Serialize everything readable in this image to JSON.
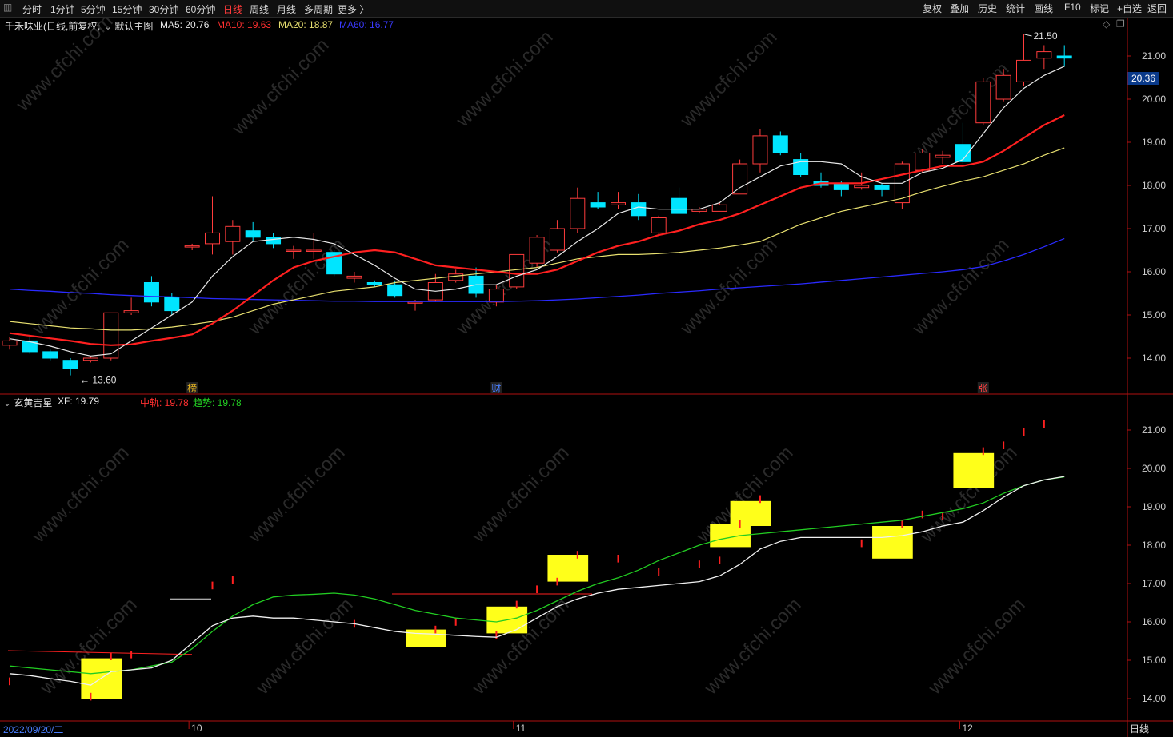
{
  "toolbar": {
    "left_items": [
      "分时",
      "1分钟",
      "5分钟",
      "15分钟",
      "30分钟",
      "60分钟",
      "日线",
      "周线",
      "月线",
      "多周期",
      "更多 〉"
    ],
    "active": "日线",
    "right_items": [
      "复权",
      "叠加",
      "历史",
      "统计",
      "画线",
      "F10",
      "标记",
      "+自选",
      "返回"
    ]
  },
  "main_panel": {
    "title": "千禾味业(日线,前复权)",
    "template": "默认主图",
    "ma5": "MA5: 20.76",
    "ma10": "MA10: 19.63",
    "ma20": "MA20: 18.87",
    "ma60": "MA60: 16.77",
    "y_ticks": [
      "21.00",
      "20.00",
      "19.00",
      "18.00",
      "17.00",
      "16.00",
      "15.00",
      "14.00"
    ],
    "current_price": "20.36",
    "high_label": "21.50",
    "low_label": "13.60",
    "markers": [
      "榜",
      "财",
      "张"
    ]
  },
  "sub_panel": {
    "title": "玄黄吉星",
    "xf": "XF: 19.79",
    "zhonggui": "中轨: 19.78",
    "qushi": "趋势: 19.78",
    "y_ticks": [
      "21.00",
      "20.00",
      "19.00",
      "18.00",
      "17.00",
      "16.00",
      "15.00",
      "14.00"
    ]
  },
  "x_axis": {
    "start_date": "2022/09/20/二",
    "month_labels": [
      "10",
      "11",
      "12"
    ],
    "period": "日线"
  },
  "watermark": "www.cfchi.com",
  "colors": {
    "up": "#ff3c3c",
    "down": "#00e5ff",
    "ma5": "#e8e8e8",
    "ma10": "#ff2020",
    "ma20": "#e8e070",
    "ma60": "#2a2aff",
    "signal_box": "#ffff1a",
    "trend_green": "#22cc22"
  },
  "chart_data": {
    "type": "candlestick",
    "ohlc": [
      [
        14.3,
        14.5,
        14.2,
        14.4
      ],
      [
        14.4,
        14.5,
        14.1,
        14.15
      ],
      [
        14.15,
        14.2,
        13.95,
        14.0
      ],
      [
        13.95,
        14.0,
        13.6,
        13.75
      ],
      [
        13.95,
        14.05,
        13.9,
        14.0
      ],
      [
        14.0,
        15.05,
        13.95,
        15.05
      ],
      [
        15.05,
        15.4,
        15.0,
        15.1
      ],
      [
        15.75,
        15.9,
        15.2,
        15.3
      ],
      [
        15.4,
        15.5,
        15.0,
        15.1
      ],
      [
        16.6,
        16.65,
        16.5,
        16.6
      ],
      [
        16.65,
        17.75,
        16.4,
        16.9
      ],
      [
        16.7,
        17.2,
        16.4,
        17.05
      ],
      [
        16.95,
        17.15,
        16.7,
        16.8
      ],
      [
        16.8,
        16.9,
        16.55,
        16.65
      ],
      [
        16.5,
        16.6,
        16.3,
        16.5
      ],
      [
        16.5,
        16.9,
        16.3,
        16.5
      ],
      [
        16.45,
        16.5,
        15.9,
        15.95
      ],
      [
        15.85,
        16.0,
        15.75,
        15.9
      ],
      [
        15.75,
        15.8,
        15.65,
        15.7
      ],
      [
        15.7,
        15.8,
        15.4,
        15.45
      ],
      [
        15.3,
        15.35,
        15.1,
        15.3
      ],
      [
        15.35,
        15.95,
        15.3,
        15.75
      ],
      [
        15.8,
        16.05,
        15.75,
        15.95
      ],
      [
        15.9,
        16.1,
        15.4,
        15.5
      ],
      [
        15.3,
        15.7,
        15.2,
        15.6
      ],
      [
        15.65,
        16.4,
        15.6,
        16.4
      ],
      [
        16.2,
        16.85,
        16.1,
        16.8
      ],
      [
        16.5,
        17.2,
        16.45,
        17.0
      ],
      [
        17.0,
        17.95,
        16.9,
        17.7
      ],
      [
        17.6,
        17.85,
        17.45,
        17.5
      ],
      [
        17.55,
        17.85,
        17.45,
        17.6
      ],
      [
        17.6,
        17.8,
        17.2,
        17.3
      ],
      [
        16.9,
        17.3,
        16.85,
        17.25
      ],
      [
        17.7,
        17.95,
        17.35,
        17.35
      ],
      [
        17.4,
        17.5,
        17.35,
        17.45
      ],
      [
        17.4,
        17.6,
        17.4,
        17.55
      ],
      [
        17.8,
        18.6,
        17.8,
        18.5
      ],
      [
        18.5,
        19.3,
        18.3,
        19.15
      ],
      [
        19.15,
        19.25,
        18.7,
        18.75
      ],
      [
        18.6,
        18.75,
        18.2,
        18.25
      ],
      [
        18.1,
        18.3,
        17.95,
        18.0
      ],
      [
        18.05,
        18.1,
        17.75,
        17.9
      ],
      [
        17.95,
        18.3,
        17.9,
        18.0
      ],
      [
        18.0,
        18.05,
        17.75,
        17.9
      ],
      [
        17.6,
        18.55,
        17.45,
        18.5
      ],
      [
        18.35,
        18.85,
        18.3,
        18.75
      ],
      [
        18.65,
        18.8,
        18.5,
        18.7
      ],
      [
        18.95,
        19.45,
        18.5,
        18.55
      ],
      [
        19.45,
        20.5,
        19.4,
        20.4
      ],
      [
        20.0,
        20.7,
        19.95,
        20.55
      ],
      [
        20.4,
        21.5,
        20.3,
        20.9
      ],
      [
        20.95,
        21.25,
        20.7,
        21.1
      ],
      [
        21.0,
        21.25,
        20.75,
        20.95
      ]
    ],
    "ma5": [
      14.45,
      14.38,
      14.28,
      14.15,
      14.05,
      14.1,
      14.4,
      14.7,
      15.0,
      15.3,
      15.9,
      16.35,
      16.7,
      16.75,
      16.8,
      16.75,
      16.65,
      16.4,
      16.15,
      15.85,
      15.6,
      15.55,
      15.6,
      15.7,
      15.7,
      15.9,
      16.05,
      16.35,
      16.7,
      17.0,
      17.35,
      17.5,
      17.45,
      17.45,
      17.45,
      17.6,
      17.95,
      18.2,
      18.45,
      18.55,
      18.55,
      18.5,
      18.2,
      18.05,
      18.05,
      18.3,
      18.4,
      18.6,
      19.2,
      19.8,
      20.25,
      20.55,
      20.76
    ],
    "ma10": [
      14.58,
      14.52,
      14.46,
      14.4,
      14.33,
      14.3,
      14.32,
      14.4,
      14.47,
      14.55,
      14.8,
      15.1,
      15.45,
      15.8,
      16.1,
      16.25,
      16.35,
      16.45,
      16.5,
      16.45,
      16.3,
      16.15,
      16.1,
      16.05,
      16.0,
      15.95,
      15.95,
      16.05,
      16.25,
      16.45,
      16.6,
      16.7,
      16.85,
      16.95,
      17.1,
      17.2,
      17.35,
      17.55,
      17.75,
      17.95,
      18.05,
      18.05,
      18.05,
      18.15,
      18.25,
      18.35,
      18.45,
      18.45,
      18.55,
      18.8,
      19.1,
      19.4,
      19.63
    ],
    "ma20": [
      14.85,
      14.8,
      14.75,
      14.7,
      14.68,
      14.65,
      14.65,
      14.68,
      14.72,
      14.78,
      14.85,
      14.95,
      15.1,
      15.25,
      15.35,
      15.45,
      15.55,
      15.6,
      15.65,
      15.75,
      15.8,
      15.85,
      15.9,
      15.95,
      16.0,
      16.05,
      16.1,
      16.2,
      16.3,
      16.35,
      16.4,
      16.4,
      16.42,
      16.45,
      16.5,
      16.55,
      16.62,
      16.7,
      16.9,
      17.1,
      17.25,
      17.4,
      17.5,
      17.6,
      17.7,
      17.85,
      17.98,
      18.1,
      18.2,
      18.35,
      18.5,
      18.7,
      18.87
    ],
    "ma60": [
      15.6,
      15.57,
      15.55,
      15.52,
      15.5,
      15.47,
      15.45,
      15.43,
      15.42,
      15.4,
      15.38,
      15.37,
      15.36,
      15.35,
      15.34,
      15.33,
      15.32,
      15.32,
      15.31,
      15.31,
      15.31,
      15.31,
      15.31,
      15.31,
      15.31,
      15.32,
      15.33,
      15.35,
      15.37,
      15.4,
      15.43,
      15.46,
      15.5,
      15.53,
      15.56,
      15.6,
      15.63,
      15.66,
      15.69,
      15.72,
      15.76,
      15.8,
      15.84,
      15.88,
      15.92,
      15.96,
      16.0,
      16.05,
      16.12,
      16.25,
      16.4,
      16.58,
      16.77
    ],
    "sub_white": [
      14.65,
      14.6,
      14.52,
      14.45,
      14.35,
      14.7,
      14.75,
      14.8,
      15.0,
      15.45,
      15.9,
      16.1,
      16.15,
      16.1,
      16.1,
      16.05,
      16.0,
      15.95,
      15.85,
      15.75,
      15.7,
      15.68,
      15.65,
      15.62,
      15.6,
      15.8,
      16.1,
      16.4,
      16.6,
      16.75,
      16.85,
      16.9,
      16.95,
      17.0,
      17.05,
      17.2,
      17.5,
      17.9,
      18.1,
      18.2,
      18.2,
      18.2,
      18.2,
      18.2,
      18.25,
      18.35,
      18.5,
      18.6,
      18.9,
      19.25,
      19.55,
      19.7,
      19.79
    ],
    "sub_green": [
      14.85,
      14.8,
      14.75,
      14.7,
      14.65,
      14.7,
      14.75,
      14.85,
      14.95,
      15.3,
      15.75,
      16.15,
      16.45,
      16.65,
      16.7,
      16.72,
      16.75,
      16.7,
      16.6,
      16.45,
      16.3,
      16.2,
      16.1,
      16.05,
      16.0,
      16.1,
      16.3,
      16.55,
      16.8,
      17.0,
      17.15,
      17.35,
      17.6,
      17.8,
      18.0,
      18.15,
      18.25,
      18.3,
      18.35,
      18.4,
      18.45,
      18.5,
      18.55,
      18.6,
      18.65,
      18.75,
      18.85,
      18.95,
      19.1,
      19.35,
      19.55,
      19.7,
      19.78
    ],
    "signal_boxes": [
      {
        "x0": 4,
        "x1": 6,
        "top": 15.05,
        "bottom": 14.0
      },
      {
        "x0": 20,
        "x1": 22,
        "top": 15.8,
        "bottom": 15.35
      },
      {
        "x0": 24,
        "x1": 26,
        "top": 16.4,
        "bottom": 15.7
      },
      {
        "x0": 27,
        "x1": 29,
        "top": 17.75,
        "bottom": 17.05
      },
      {
        "x0": 35,
        "x1": 37,
        "top": 18.55,
        "bottom": 17.95
      },
      {
        "x0": 36,
        "x1": 38,
        "top": 19.15,
        "bottom": 18.5
      },
      {
        "x0": 43,
        "x1": 45,
        "top": 18.5,
        "bottom": 17.65
      },
      {
        "x0": 47,
        "x1": 49,
        "top": 20.4,
        "bottom": 19.5
      }
    ],
    "y_range": [
      13.7,
      21.8
    ]
  }
}
